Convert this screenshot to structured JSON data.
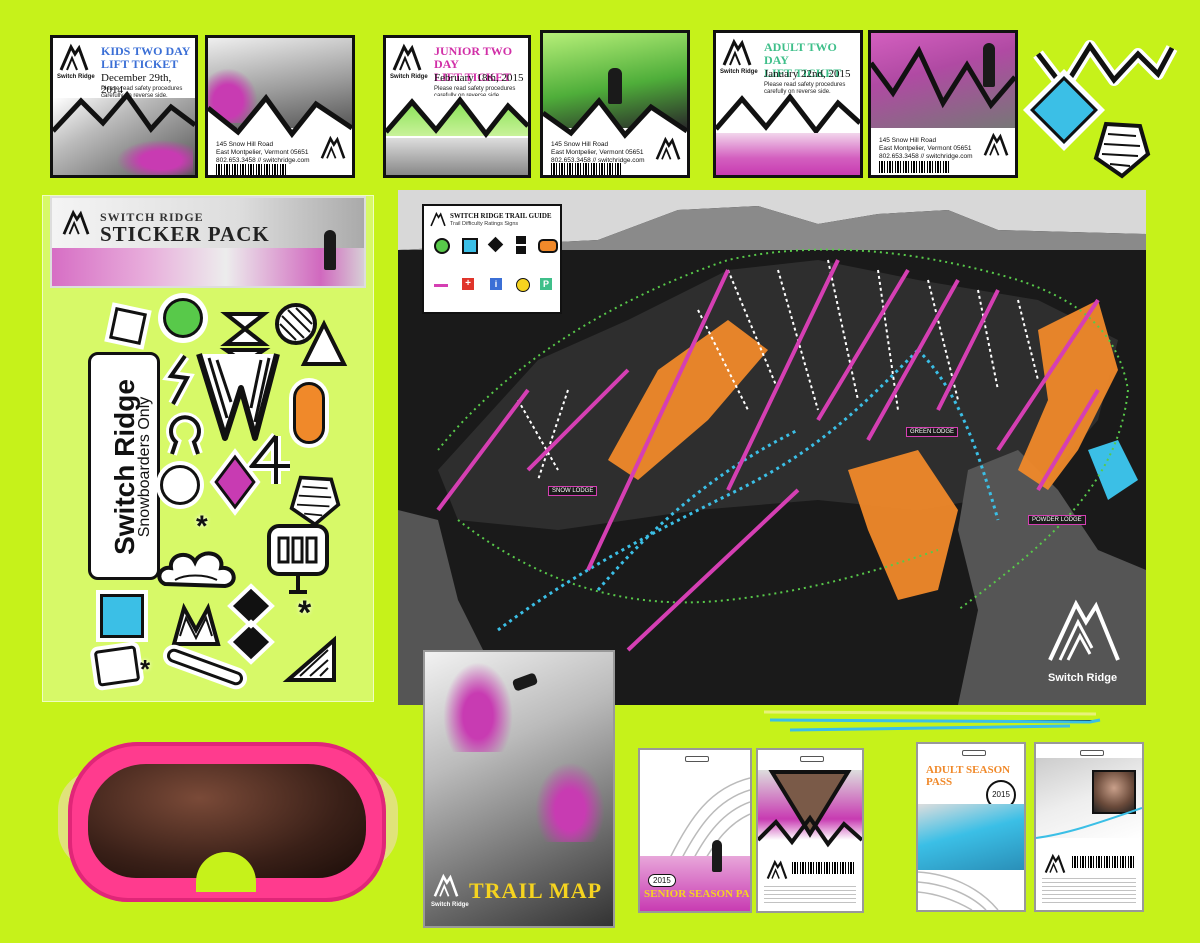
{
  "brand": {
    "name": "Switch Ridge",
    "tagline": "Snowboarders Only"
  },
  "tickets": [
    {
      "title_line1": "KIDS TWO DAY",
      "title_line2": "LIFT TICKET",
      "date": "December 29th, 2014",
      "accent": "#3b6fd6"
    },
    {
      "title_line1": "JUNIOR TWO DAY",
      "title_line2": "LIFT TICKET",
      "date": "February 18th, 2015",
      "accent": "#d12fa7"
    },
    {
      "title_line1": "ADULT TWO DAY",
      "title_line2": "LIFT TICKET",
      "date": "January 22nd, 2015",
      "accent": "#3fbf8a"
    }
  ],
  "ticket_small": "Please read safety procedures carefully on reverse side.",
  "address": {
    "line1": "145 Snow Hill Road",
    "line2_a": "East Montpelier, Vermont 05651",
    "line2_b": "East Montpelier, Vermont 05651",
    "line3": "802.653.3458 // switchridge.com"
  },
  "sticker_pack": {
    "line1": "SWITCH RIDGE",
    "line2": "STICKER PACK"
  },
  "trail_guide": {
    "title": "SWITCH RIDGE TRAIL GUIDE",
    "subtitle": "Trail Difficulty Ratings Signs"
  },
  "map_lodges": [
    "SNOW LODGE",
    "GREEN LODGE",
    "POWDER LODGE"
  ],
  "booklet": {
    "title": "TRAIL MAP"
  },
  "passes": [
    {
      "title": "SENIOR SEASON PASS",
      "year": "2015"
    },
    {
      "title": "ADULT SEASON PASS",
      "year": "2015"
    }
  ],
  "colors": {
    "background": "#c6f21a",
    "magenta": "#d53fb3",
    "orange": "#f0892a",
    "cyan": "#3bbfe6",
    "green": "#58c94a",
    "map": "#1a1a1a",
    "goggle": "#ff3b8e"
  }
}
